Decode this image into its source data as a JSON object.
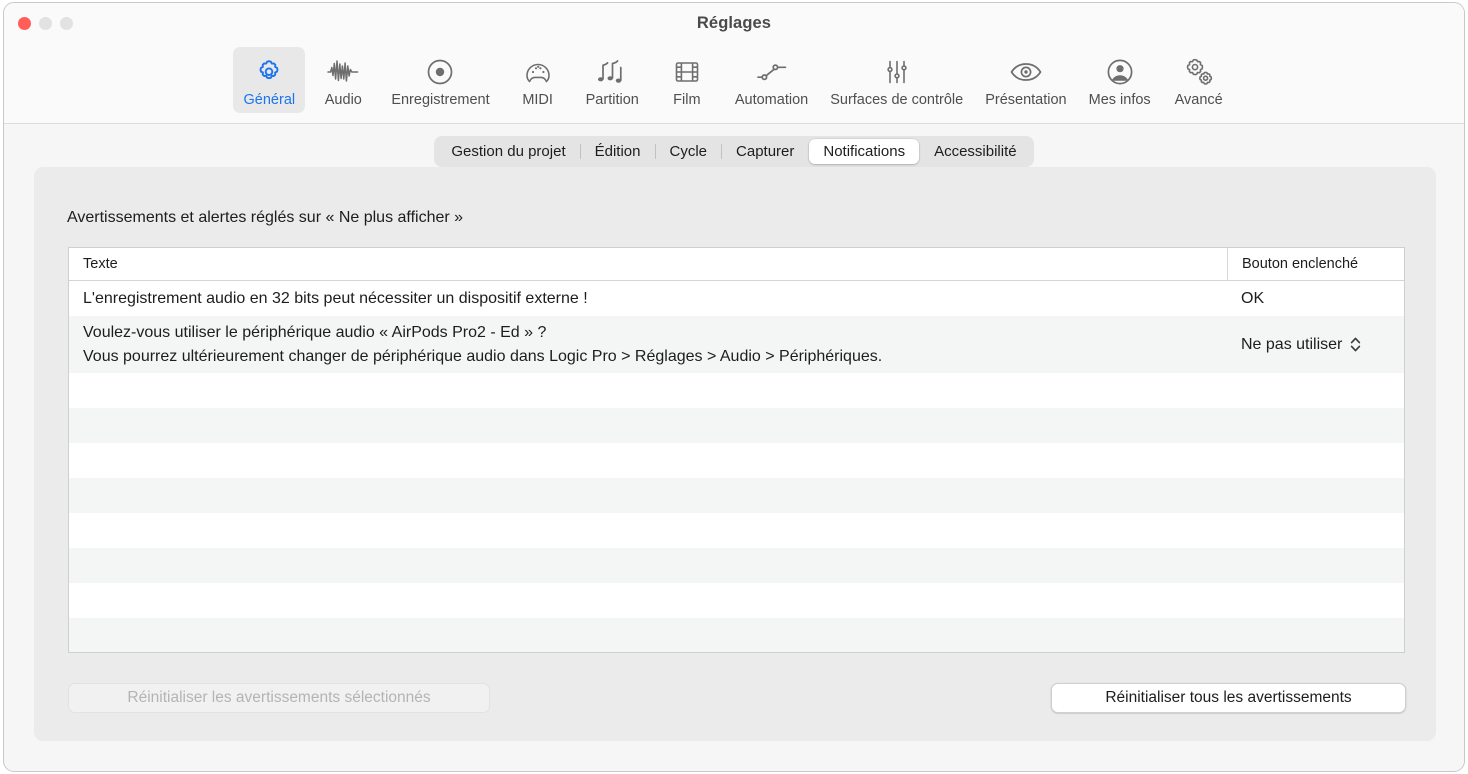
{
  "window": {
    "title": "Réglages",
    "traffic_lights": [
      "close",
      "minimize",
      "maximize"
    ]
  },
  "toolbar": {
    "items": [
      {
        "label": "Général",
        "icon": "gear-icon",
        "selected": true
      },
      {
        "label": "Audio",
        "icon": "waveform-icon",
        "selected": false
      },
      {
        "label": "Enregistrement",
        "icon": "record-circle-icon",
        "selected": false
      },
      {
        "label": "MIDI",
        "icon": "midi-plug-icon",
        "selected": false
      },
      {
        "label": "Partition",
        "icon": "music-notes-icon",
        "selected": false
      },
      {
        "label": "Film",
        "icon": "film-strip-icon",
        "selected": false
      },
      {
        "label": "Automation",
        "icon": "automation-node-icon",
        "selected": false
      },
      {
        "label": "Surfaces de contrôle",
        "icon": "sliders-icon",
        "selected": false
      },
      {
        "label": "Présentation",
        "icon": "eye-icon",
        "selected": false
      },
      {
        "label": "Mes infos",
        "icon": "user-circle-icon",
        "selected": false
      },
      {
        "label": "Avancé",
        "icon": "double-gear-icon",
        "selected": false
      }
    ],
    "accent_color": "#1c74ef",
    "selected_bg": "#e8e8e8"
  },
  "tabs": {
    "items": [
      {
        "label": "Gestion du projet",
        "active": false
      },
      {
        "label": "Édition",
        "active": false
      },
      {
        "label": "Cycle",
        "active": false
      },
      {
        "label": "Capturer",
        "active": false
      },
      {
        "label": "Notifications",
        "active": true
      },
      {
        "label": "Accessibilité",
        "active": false
      }
    ]
  },
  "panel": {
    "caption": "Avertissements et alertes réglés sur « Ne plus afficher »",
    "table": {
      "columns": [
        "Texte",
        "Bouton enclenché"
      ],
      "rows": [
        {
          "text_lines": [
            "L'enregistrement audio en 32 bits peut nécessiter un dispositif externe !"
          ],
          "button": "OK",
          "has_stepper": false
        },
        {
          "text_lines": [
            "Voulez-vous utiliser le périphérique audio « AirPods Pro2 - Ed » ?",
            "Vous pourrez ultérieurement changer de périphérique audio dans Logic Pro > Réglages > Audio > Périphériques."
          ],
          "button": "Ne pas utiliser",
          "has_stepper": true
        }
      ],
      "empty_row_count": 8
    },
    "buttons": {
      "reset_selected": "Réinitialiser les avertissements sélectionnés",
      "reset_all": "Réinitialiser tous les avertissements"
    }
  }
}
